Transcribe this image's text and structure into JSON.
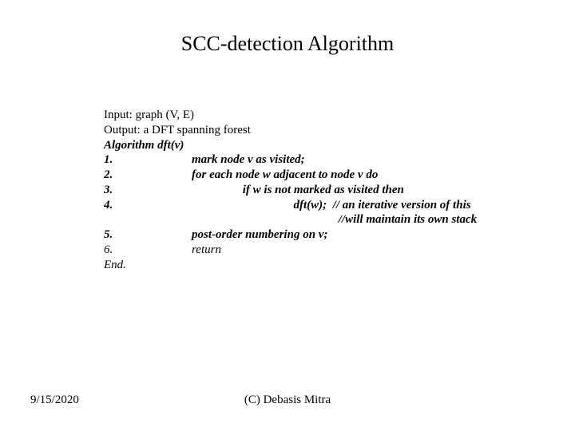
{
  "title": "SCC-detection Algorithm",
  "body": {
    "input_line": "Input: graph (V, E)",
    "output_line": "Output: a DFT spanning forest",
    "algo_header": "Algorithm dft(v)",
    "lines": [
      {
        "num": "1.",
        "text": "mark node v as visited;"
      },
      {
        "num": "2.",
        "text": "for each node w adjacent to node v do"
      },
      {
        "num": "3.",
        "text": "                 if w is not marked as visited then"
      },
      {
        "num": "4.",
        "text": "                                  dft(w);  // an iterative version of this"
      }
    ],
    "comment_continuation": "                                                 //will maintain its own stack",
    "line5": {
      "num": "5.",
      "text": "post-order numbering on v;"
    },
    "line6": {
      "num": "6.",
      "text": "return"
    },
    "end": "End."
  },
  "footer": {
    "date": "9/15/2020",
    "copyright": "(C) Debasis Mitra"
  }
}
